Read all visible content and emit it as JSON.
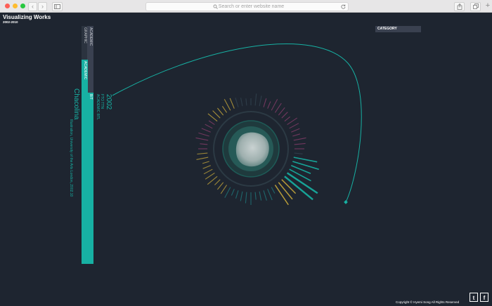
{
  "browser": {
    "url_placeholder": "Search or enter website name",
    "traffic_lights": [
      "#fd5f57",
      "#febc2e",
      "#28c840"
    ],
    "back_icon": "chevron-left-icon",
    "forward_icon": "chevron-right-icon"
  },
  "site": {
    "title": "Visualizing Works",
    "subtitle": "2002-2010",
    "category_label": "CATEGORY",
    "footer": "Copyright © Hyemi Song All Rights Reserved",
    "social": {
      "twitter": "t",
      "facebook": "f"
    }
  },
  "detail": {
    "year": "2002",
    "type": "FTO TTN",
    "discipline": "ACADEMIC BTL",
    "work_title": "Chacolina",
    "work_desc": "Illustration, University of the Arts London, 2002.10",
    "tab_graphic": "GRAPHIC",
    "tab_academic": "ACADEMIC",
    "tab_bit": "BIT"
  },
  "colors": {
    "background": "#1e2530",
    "accent": "#17b1a3",
    "orange": "#c7a83b",
    "purple": "#7a3a63",
    "panel": "#3a4150"
  }
}
